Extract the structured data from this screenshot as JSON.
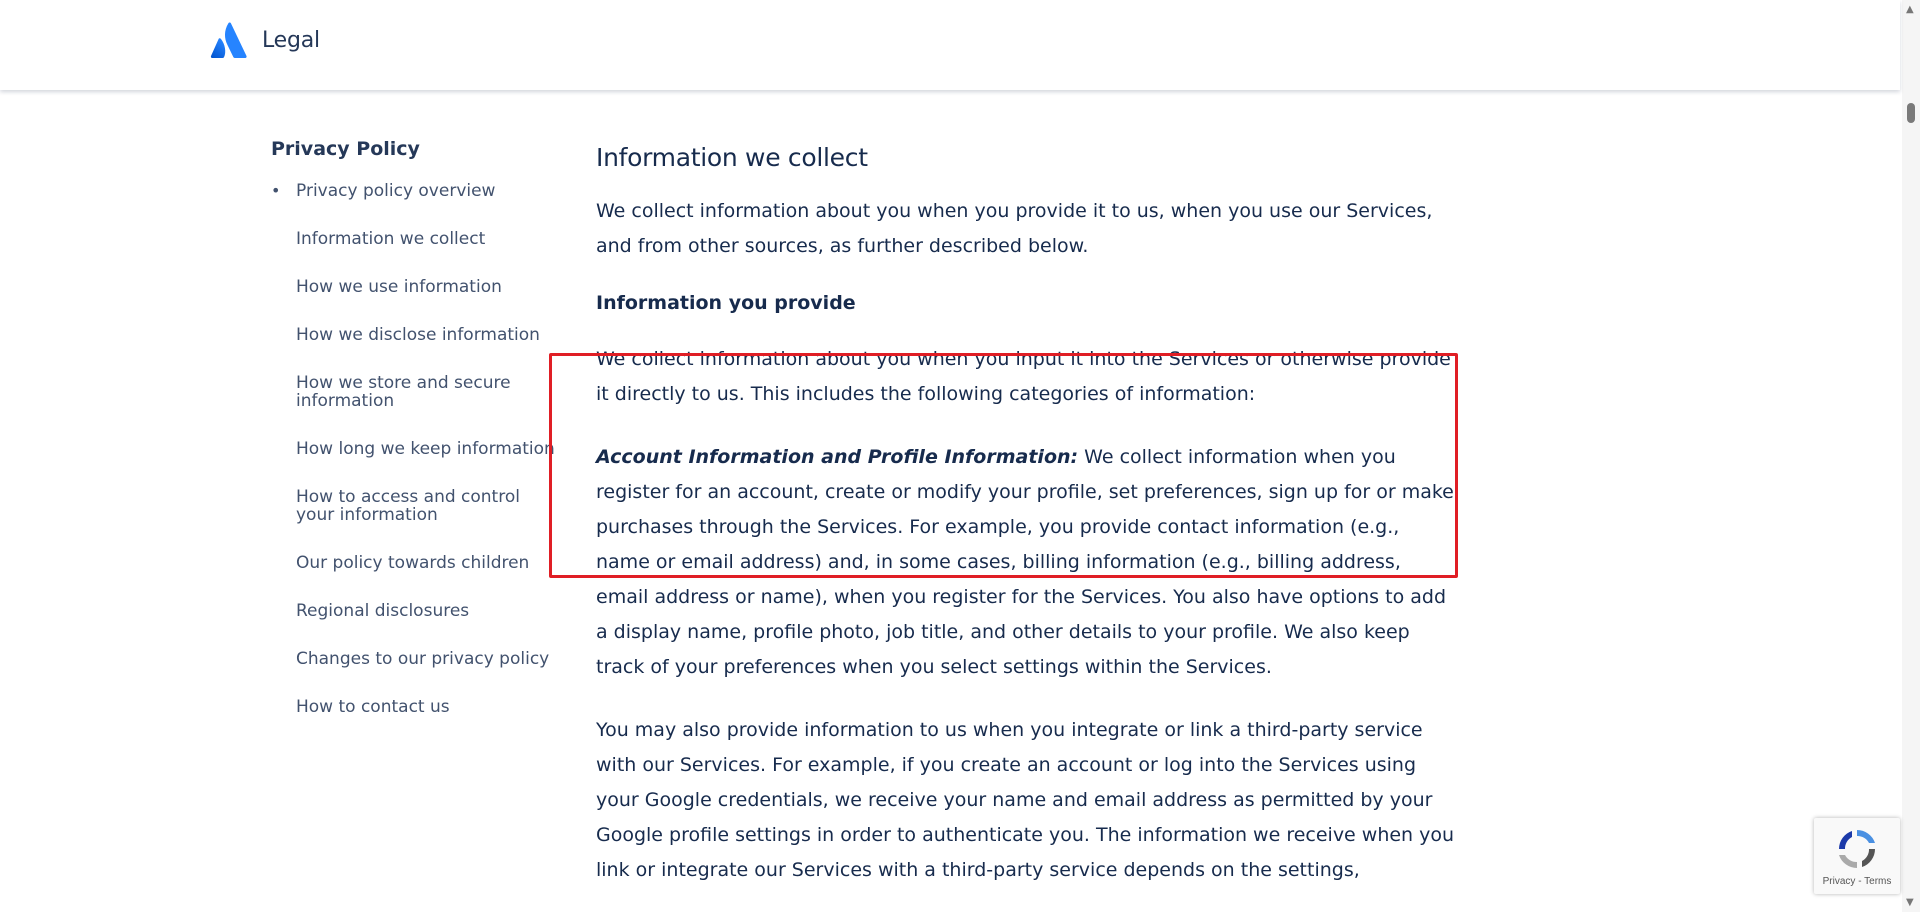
{
  "header": {
    "brand": "Legal"
  },
  "sidebar": {
    "title": "Privacy Policy",
    "items": [
      {
        "label": "Privacy policy overview",
        "active": true
      },
      {
        "label": "Information we collect"
      },
      {
        "label": "How we use information"
      },
      {
        "label": "How we disclose information"
      },
      {
        "label": "How we store and secure information"
      },
      {
        "label": "How long we keep information"
      },
      {
        "label": "How to access and control your information"
      },
      {
        "label": "Our policy towards children"
      },
      {
        "label": "Regional disclosures"
      },
      {
        "label": "Changes to our privacy policy"
      },
      {
        "label": "How to contact us"
      }
    ]
  },
  "main": {
    "heading": "Information we collect",
    "intro": "We collect information about you when you provide it to us, when you use our Services, and from other sources, as further described below.",
    "subheading": "Information you provide",
    "para1": "We collect information about you when you input it into the Services or otherwise provide it directly to us. This includes the following categories of information:",
    "para2_lead": "Account Information and Profile Information:",
    "para2_body": " We collect information when you register for an account, create or modify your profile, set preferences, sign up for or make purchases through the Services. For example, you provide contact information (e.g., name or email address) and, in some cases, billing information (e.g., billing address, email address or name), when you register for the Services. You also have options to add a display name, profile photo, job title, and other details to your profile. We also keep track of your preferences when you select settings within the Services.",
    "para3": "You may also provide information to us when you integrate or link a third-party service with our Services. For example, if you create an account or log into the Services using your Google credentials, we receive your name and email address as permitted by your Google profile settings in order to authenticate you. The information we receive when you link or integrate our Services with a third-party service depends on the settings,"
  },
  "recaptcha": {
    "links": "Privacy - Terms"
  },
  "colors": {
    "brand_blue": "#0052cc",
    "highlight": "#e01e25",
    "text": "#172b4d"
  }
}
